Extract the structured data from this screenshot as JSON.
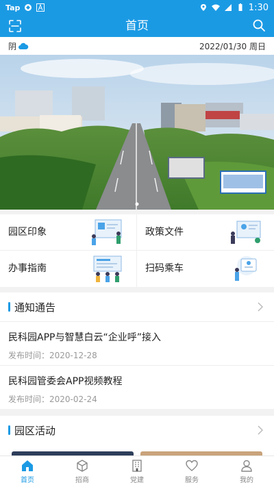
{
  "status": {
    "carrier": "Tap",
    "time": "1:30"
  },
  "header": {
    "title": "首页"
  },
  "info": {
    "weather": "阴",
    "date": "2022/01/30 周日"
  },
  "grid": [
    {
      "label": "园区印象"
    },
    {
      "label": "政策文件"
    },
    {
      "label": "办事指南"
    },
    {
      "label": "扫码乘车"
    }
  ],
  "notices": {
    "title": "通知通告",
    "items": [
      {
        "title": "民科园APP与智慧白云“企业呼”接入",
        "date": "发布时间：2020-12-28"
      },
      {
        "title": "民科园管委会APP视频教程",
        "date": "发布时间：2020-02-24"
      }
    ]
  },
  "activities": {
    "title": "园区活动"
  },
  "tabs": [
    {
      "label": "首页"
    },
    {
      "label": "招商"
    },
    {
      "label": "党建"
    },
    {
      "label": "服务"
    },
    {
      "label": "我的"
    }
  ],
  "colors": {
    "primary": "#1b9ae4"
  }
}
